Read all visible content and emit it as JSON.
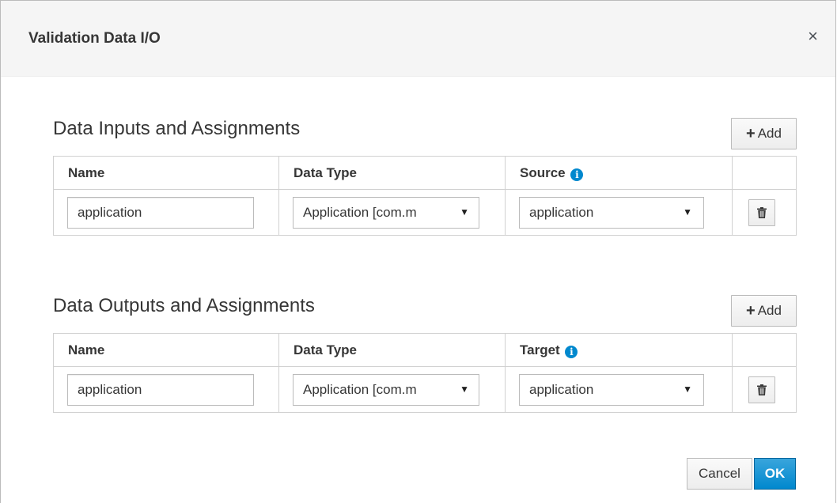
{
  "dialog": {
    "title": "Validation Data I/O",
    "close_glyph": "×"
  },
  "inputs": {
    "title": "Data Inputs and Assignments",
    "add_label": "Add",
    "columns": {
      "name": "Name",
      "data_type": "Data Type",
      "source": "Source"
    },
    "rows": [
      {
        "name": "application",
        "data_type": "Application [com.m",
        "source": "application"
      }
    ]
  },
  "outputs": {
    "title": "Data Outputs and Assignments",
    "add_label": "Add",
    "columns": {
      "name": "Name",
      "data_type": "Data Type",
      "target": "Target"
    },
    "rows": [
      {
        "name": "application",
        "data_type": "Application [com.m",
        "target": "application"
      }
    ]
  },
  "footer": {
    "cancel_label": "Cancel",
    "ok_label": "OK"
  },
  "icons": {
    "info": "info-circle-icon",
    "trash": "trash-icon",
    "plus": "plus-icon",
    "dropdown": "caret-down-icon",
    "close": "close-icon"
  },
  "colors": {
    "primary": "#0088ce",
    "info": "#0088ce",
    "header_bg": "#f5f5f5"
  }
}
